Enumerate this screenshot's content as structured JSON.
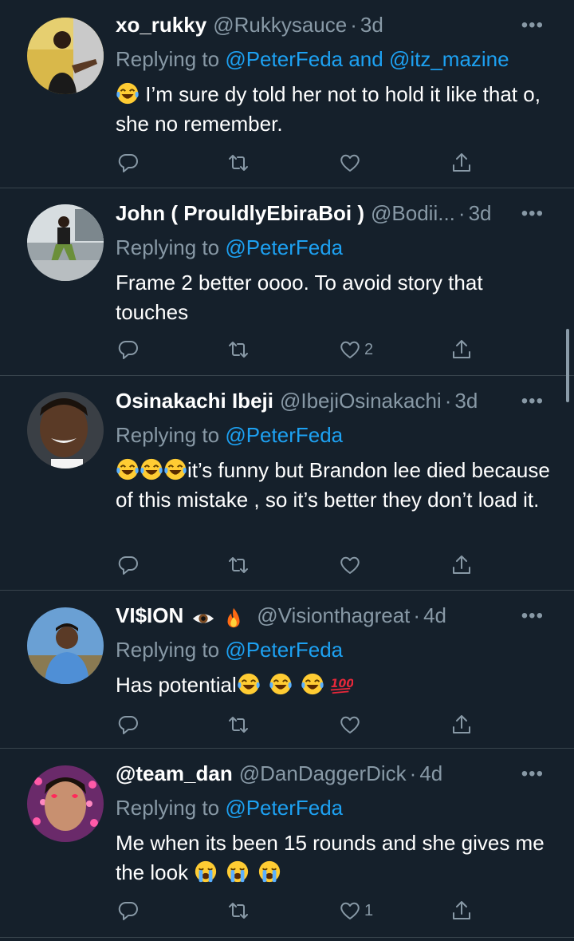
{
  "tweets": [
    {
      "name": "xo_rukky",
      "handle": "@Rukkysauce",
      "time": "3d",
      "replying_prefix": "Replying to ",
      "replying_to": "@PeterFeda and @itz_mazine",
      "text_segments": [
        "",
        "I’m sure dy told her not to hold it like that o, she no remember."
      ],
      "emojis": [
        "laughing-tears"
      ],
      "likes": ""
    },
    {
      "name": "John ( ProuldlyEbiraBoi )",
      "handle": "@Bodii...",
      "time": "3d",
      "replying_prefix": "Replying to ",
      "replying_to": "@PeterFeda",
      "text_segments": [
        "Frame 2 better oooo. To avoid story that touches"
      ],
      "emojis": [],
      "likes": "2"
    },
    {
      "name": "Osinakachi Ibeji",
      "handle": "@IbejiOsinakachi",
      "time": "3d",
      "replying_prefix": "Replying to ",
      "replying_to": "@PeterFeda",
      "text_segments": [
        "",
        "it’s funny but Brandon lee died because of this mistake , so it’s better they don’t load it."
      ],
      "emojis": [
        "laughing-tears",
        "laughing-tears",
        "laughing-tears"
      ],
      "likes": ""
    },
    {
      "name": "VI$ION",
      "handle": "@Visionthagreat",
      "time": "4d",
      "replying_prefix": "Replying to ",
      "replying_to": "@PeterFeda",
      "text_segments": [
        "Has potential"
      ],
      "emojis": [
        "laughing-tears",
        "laughing-tears",
        "laughing-tears",
        "hundred"
      ],
      "likes": ""
    },
    {
      "name": "@team_dan",
      "handle": "@DanDaggerDick",
      "time": "4d",
      "replying_prefix": "Replying to ",
      "replying_to": "@PeterFeda",
      "text_segments": [
        "Me when its been 15 rounds and she gives me the look "
      ],
      "emojis": [
        "crying",
        "crying",
        "crying"
      ],
      "likes": "1"
    }
  ],
  "common": {
    "separator": "·",
    "more_glyph": "•••"
  },
  "colors": {
    "background": "#15202b",
    "secondary_text": "#8899a6",
    "link": "#1da1f2",
    "divider": "#38444d"
  }
}
